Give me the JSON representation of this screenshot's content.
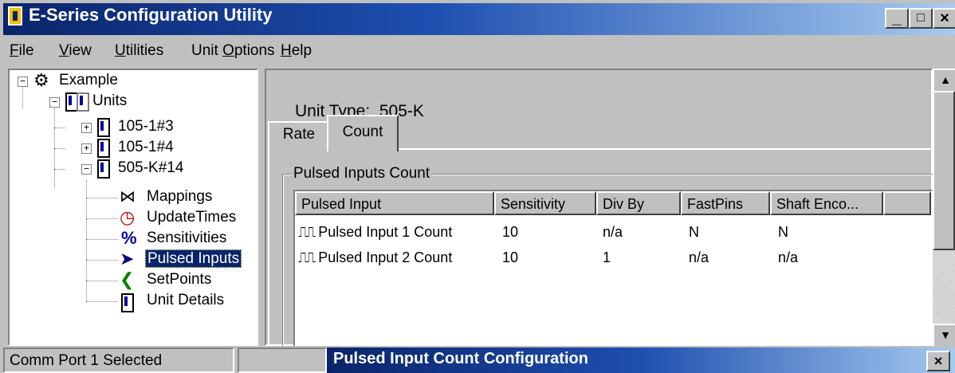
{
  "window": {
    "title": "E-Series Configuration Utility",
    "minimize": "_",
    "maximize": "□",
    "close": "×"
  },
  "menu": [
    {
      "label": "File",
      "u": "F",
      "rest": "ile"
    },
    {
      "label": "View",
      "u": "V",
      "rest": "iew"
    },
    {
      "label": "Utilities",
      "u": "U",
      "rest": "tilities"
    },
    {
      "label": "Unit Options",
      "pre": "Unit ",
      "u": "O",
      "rest": "ptions"
    },
    {
      "label": "Help",
      "u": "H",
      "rest": "elp"
    }
  ],
  "tree": {
    "root": "Example",
    "units": "Units",
    "unit1": "105-1#3",
    "unit2": "105-1#4",
    "unit3": "505-K#14",
    "children": [
      "Mappings",
      "UpdateTimes",
      "Sensitivities",
      "Pulsed Inputs",
      "SetPoints",
      "Unit Details"
    ],
    "selected": "Pulsed Inputs"
  },
  "panel": {
    "unit_type_label": "Unit Type:",
    "unit_type_value": "505-K",
    "tabs": [
      "Rate",
      "Count"
    ],
    "active_tab": "Count",
    "group_label": "Pulsed Inputs Count",
    "columns": [
      "Pulsed Input",
      "Sensitivity",
      "Div By",
      "FastPins",
      "Shaft Enco..."
    ],
    "rows": [
      [
        "Pulsed Input 1 Count",
        "10",
        "n/a",
        "N",
        "N"
      ],
      [
        "Pulsed Input 2 Count",
        "10",
        "1",
        "n/a",
        "n/a"
      ]
    ]
  },
  "statusbar": {
    "text": "Comm Port 1 Selected"
  },
  "dialog": {
    "title": "Pulsed Input Count Configuration",
    "close": "×"
  },
  "icons": {
    "pulse": "pulse-wave-icon"
  }
}
